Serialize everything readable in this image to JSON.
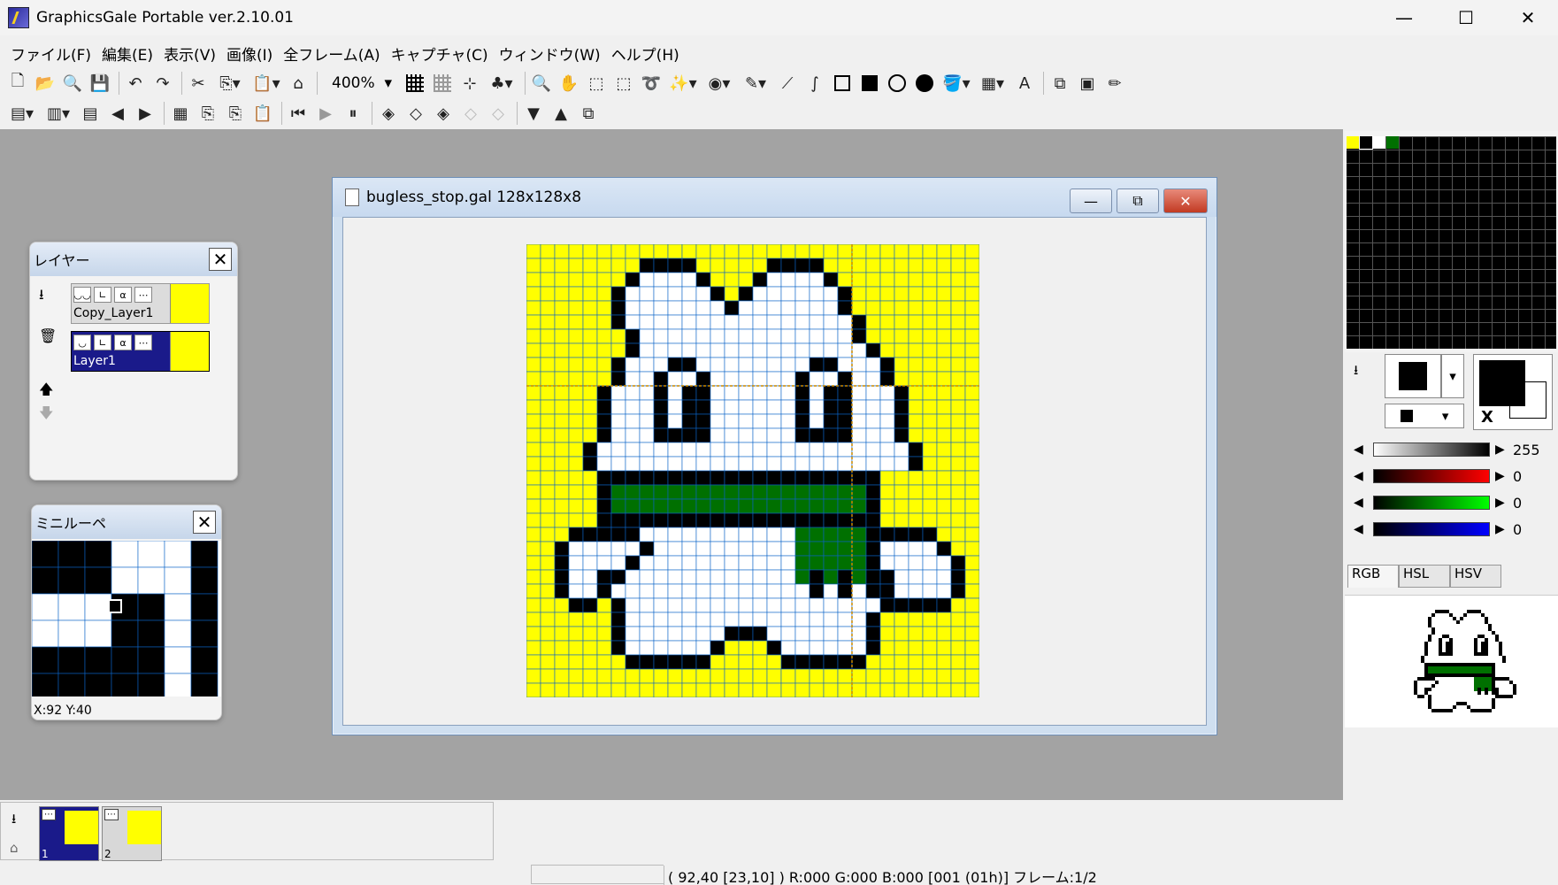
{
  "app": {
    "title": "GraphicsGale Portable ver.2.10.01",
    "controls": {
      "minimize": "—",
      "maximize": "☐",
      "close": "✕"
    }
  },
  "menu": [
    "ファイル(F)",
    "編集(E)",
    "表示(V)",
    "画像(I)",
    "全フレーム(A)",
    "キャプチャ(C)",
    "ウィンドウ(W)",
    "ヘルプ(H)"
  ],
  "toolbar": {
    "zoom": "400%"
  },
  "document": {
    "title": "bugless_stop.gal 128x128x8",
    "colors": {
      "background": "#ffff00",
      "outline": "#000000",
      "body": "#ffffff",
      "scarf": "#007000",
      "grid": "#0a64c8",
      "guide": "#c88800"
    }
  },
  "layers": {
    "title": "レイヤー",
    "items": [
      {
        "name": "Copy_Layer1",
        "selected": false
      },
      {
        "name": "Layer1",
        "selected": true
      }
    ]
  },
  "loupe": {
    "title": "ミニルーペ",
    "coords": "X:92 Y:40"
  },
  "colors": {
    "gray_value": "255",
    "r_value": "0",
    "g_value": "0",
    "b_value": "0",
    "x_label": "X",
    "tabs": [
      "RGB",
      "HSL",
      "HSV"
    ],
    "palette_first": [
      "#ffff00",
      "#000000",
      "#ffffff",
      "#007000"
    ]
  },
  "frames": {
    "items": [
      {
        "label": "1",
        "selected": true
      },
      {
        "label": "2",
        "selected": false
      }
    ]
  },
  "status": {
    "text": "( 92,40 [23,10] ) R:000 G:000 B:000  [001 (01h)]  フレーム:1/2"
  }
}
